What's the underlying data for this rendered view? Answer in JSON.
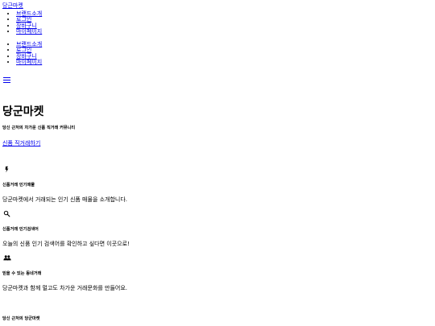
{
  "header": {
    "brand": "당근마켓"
  },
  "nav_primary": [
    {
      "label": "브랜드소개"
    },
    {
      "label": "로그인"
    },
    {
      "label": "장바구니"
    },
    {
      "label": "마이페이지"
    }
  ],
  "nav_secondary": [
    {
      "label": "브랜드소개"
    },
    {
      "label": "로그인"
    },
    {
      "label": "장바구니"
    },
    {
      "label": "마이페이지"
    }
  ],
  "hero": {
    "title": "당군마켓",
    "subtitle": "당신 근처의 차가운 신품 직거래 커뮤니티",
    "cta": "신품 직거래하기"
  },
  "features": [
    {
      "icon": "lightning-icon",
      "title": "신품거래 인기매물",
      "desc": "당군마켓에서 거래되는 인기 신품 매물을 소개합니다."
    },
    {
      "icon": "search-icon",
      "title": "신품거래 인기검색어",
      "desc": "오늘의 신품 인기 검색어를 확인하고 싶다면 이곳으로!"
    },
    {
      "icon": "people-icon",
      "title": "믿을 수 있는 동네거래",
      "desc": "당군마켓과 함께 멀고도 차가운 거래문화를 만들어요."
    }
  ],
  "footer_section": {
    "title": "당신 근처의 당군마켓"
  },
  "colors": {
    "link": "#0000ee",
    "text": "#000000",
    "background": "#ffffff"
  }
}
